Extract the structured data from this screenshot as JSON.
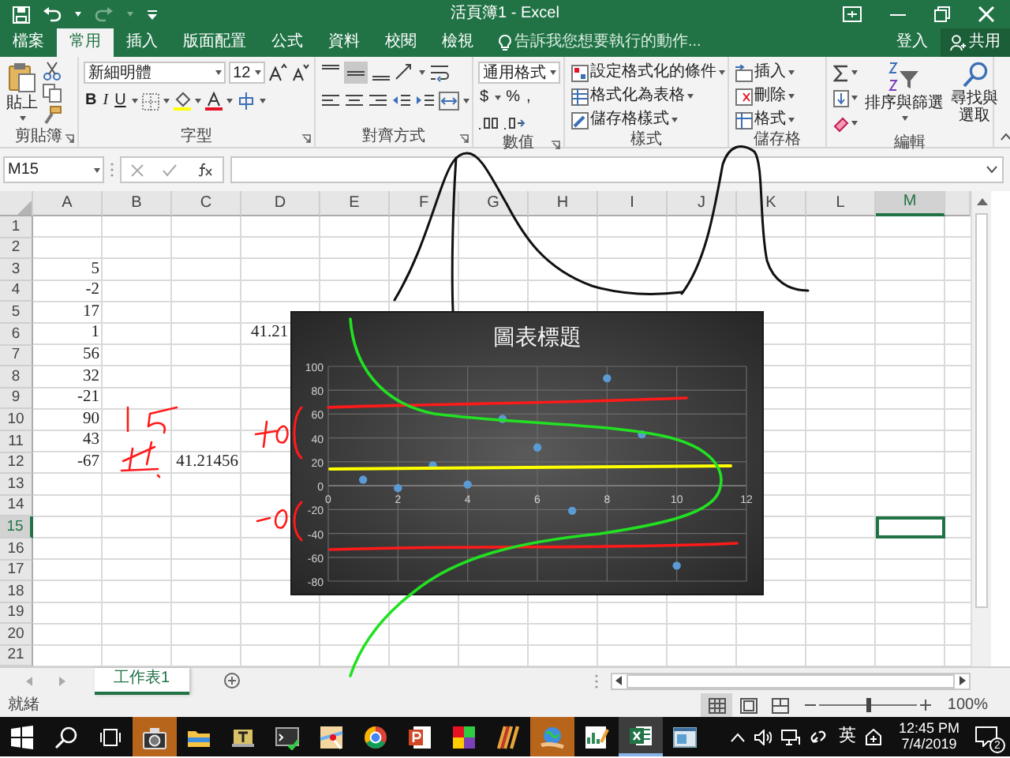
{
  "window": {
    "title": "活頁簿1 - Excel"
  },
  "ribbon_tabs": [
    {
      "label": "檔案",
      "selected": false
    },
    {
      "label": "常用",
      "selected": true
    },
    {
      "label": "插入",
      "selected": false
    },
    {
      "label": "版面配置",
      "selected": false
    },
    {
      "label": "公式",
      "selected": false
    },
    {
      "label": "資料",
      "selected": false
    },
    {
      "label": "校閱",
      "selected": false
    },
    {
      "label": "檢視",
      "selected": false
    }
  ],
  "tell_me": {
    "placeholder": "告訴我您想要執行的動作..."
  },
  "sign_in": "登入",
  "share": "共用",
  "clipboard": {
    "label": "剪貼簿",
    "paste": "貼上"
  },
  "font": {
    "label": "字型",
    "name": "新細明體",
    "size": "12",
    "bold": "B",
    "italic": "I",
    "underline": "U"
  },
  "alignment": {
    "label": "對齊方式"
  },
  "number": {
    "label": "數值",
    "format": "通用格式",
    "currency": "$",
    "percent": "%",
    "comma": ","
  },
  "styles": {
    "label": "樣式",
    "items": [
      "設定格式化的條件",
      "格式化為表格",
      "儲存格樣式"
    ]
  },
  "cells": {
    "label": "儲存格",
    "items": [
      "插入",
      "刪除",
      "格式"
    ]
  },
  "editing": {
    "label": "編輯",
    "sort": "排序與篩選",
    "find": "尋找與選取"
  },
  "formula_bar": {
    "name_box": "M15"
  },
  "sheet": {
    "columns": [
      {
        "label": "A",
        "selected": false
      },
      {
        "label": "B",
        "selected": false
      },
      {
        "label": "C",
        "selected": false
      },
      {
        "label": "D",
        "selected": false
      },
      {
        "label": "E",
        "selected": false
      },
      {
        "label": "F",
        "selected": false
      },
      {
        "label": "G",
        "selected": false
      },
      {
        "label": "H",
        "selected": false
      },
      {
        "label": "I",
        "selected": false
      },
      {
        "label": "J",
        "selected": false
      },
      {
        "label": "K",
        "selected": false
      },
      {
        "label": "L",
        "selected": false
      },
      {
        "label": "M",
        "selected": true
      }
    ],
    "rows": [
      {
        "header": "1",
        "selected": false
      },
      {
        "header": "2",
        "selected": false
      },
      {
        "header": "3",
        "selected": false,
        "cells": {
          "A": {
            "value": "5"
          }
        }
      },
      {
        "header": "4",
        "selected": false,
        "cells": {
          "A": {
            "value": "-2"
          }
        }
      },
      {
        "header": "5",
        "selected": false,
        "cells": {
          "A": {
            "value": "17"
          }
        }
      },
      {
        "header": "6",
        "selected": false,
        "cells": {
          "A": {
            "value": "1"
          },
          "D": {
            "value": "41.21",
            "kind": "text"
          }
        }
      },
      {
        "header": "7",
        "selected": false,
        "cells": {
          "A": {
            "value": "56"
          }
        }
      },
      {
        "header": "8",
        "selected": false,
        "cells": {
          "A": {
            "value": "32"
          }
        }
      },
      {
        "header": "9",
        "selected": false,
        "cells": {
          "A": {
            "value": "-21"
          }
        }
      },
      {
        "header": "10",
        "selected": false,
        "cells": {
          "A": {
            "value": "90"
          }
        }
      },
      {
        "header": "11",
        "selected": false,
        "cells": {
          "A": {
            "value": "43"
          }
        }
      },
      {
        "header": "12",
        "selected": false,
        "cells": {
          "A": {
            "value": "-67"
          },
          "C": {
            "value": "41.21456"
          }
        }
      },
      {
        "header": "13",
        "selected": false
      },
      {
        "header": "14",
        "selected": false
      },
      {
        "header": "15",
        "selected": true
      },
      {
        "header": "16",
        "selected": false
      },
      {
        "header": "17",
        "selected": false
      },
      {
        "header": "18",
        "selected": false
      },
      {
        "header": "19",
        "selected": false
      },
      {
        "header": "20",
        "selected": false
      },
      {
        "header": "21",
        "selected": false
      }
    ]
  },
  "chart": {
    "chart_data": {
      "type": "scatter",
      "title": "圖表標題",
      "x": [
        1,
        2,
        3,
        4,
        5,
        6,
        7,
        8,
        9,
        10
      ],
      "series": [
        {
          "color": "#5b9bd5",
          "values": [
            5,
            -2,
            17,
            1,
            56,
            32,
            -21,
            90,
            43,
            -67
          ]
        }
      ],
      "grid": true,
      "xlim": [
        0,
        12
      ],
      "ylim": [
        -80,
        100
      ],
      "xticks": [
        0,
        2,
        4,
        6,
        8,
        10,
        12
      ],
      "yticks": [
        -80,
        -60,
        -40,
        -20,
        0,
        20,
        40,
        60,
        80,
        100
      ]
    }
  },
  "sheet_tabs": [
    {
      "label": "工作表1",
      "selected": true
    }
  ],
  "status_bar": {
    "status": "就緒",
    "views": [
      {
        "selected": true
      },
      {
        "selected": false
      },
      {
        "selected": false
      }
    ],
    "zoom": {
      "level": 0.5,
      "reading": "100%"
    }
  },
  "taskbar": {
    "apps": [
      {
        "kind": "camera",
        "highlighted": true,
        "active": false
      },
      {
        "kind": "folder",
        "highlighted": false,
        "active": false
      },
      {
        "kind": "book",
        "highlighted": false,
        "active": false
      },
      {
        "kind": "terminal",
        "highlighted": false,
        "active": false
      },
      {
        "kind": "map",
        "highlighted": false,
        "active": false
      },
      {
        "kind": "browser",
        "highlighted": false,
        "active": false
      },
      {
        "kind": "presentation",
        "highlighted": false,
        "active": false
      },
      {
        "kind": "squares",
        "highlighted": false,
        "active": false
      },
      {
        "kind": "stripes",
        "highlighted": false,
        "active": false
      },
      {
        "kind": "globe",
        "highlighted": true,
        "active": false
      },
      {
        "kind": "chart",
        "highlighted": false,
        "active": false
      },
      {
        "kind": "spreadsheet",
        "highlighted": false,
        "active": true
      },
      {
        "kind": "window",
        "highlighted": false,
        "active": false
      }
    ],
    "ime": "英",
    "time": "12:45 PM",
    "date": "7/4/2019",
    "notifications": "2"
  }
}
